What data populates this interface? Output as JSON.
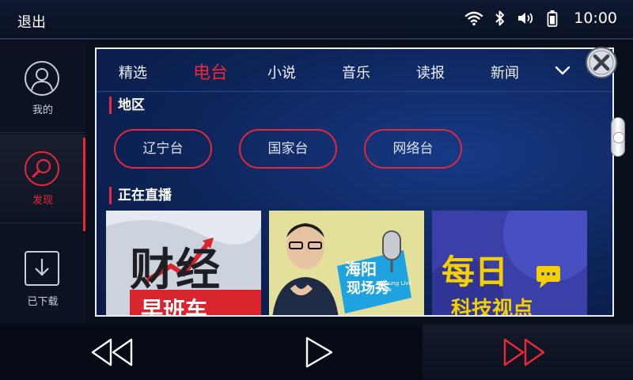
{
  "status": {
    "exit_label": "退出",
    "time": "10:00",
    "icons": [
      "wifi-icon",
      "bluetooth-icon",
      "volume-icon",
      "battery-icon"
    ]
  },
  "sidebar": {
    "items": [
      {
        "label": "我的",
        "icon": "user-icon",
        "active": false
      },
      {
        "label": "发现",
        "icon": "discover-icon",
        "active": true
      },
      {
        "label": "已下载",
        "icon": "download-icon",
        "active": false
      }
    ]
  },
  "tabs": {
    "items": [
      "精选",
      "电台",
      "小说",
      "音乐",
      "读报",
      "新闻"
    ],
    "active": "电台"
  },
  "region": {
    "title": "地区",
    "items": [
      "辽宁台",
      "国家台",
      "网络台"
    ]
  },
  "live": {
    "title": "正在直播",
    "items": [
      {
        "cover_text": "财经",
        "cover_sub": "早班车"
      },
      {
        "cover_text": "海阳",
        "cover_sub": "现场秀",
        "cover_badge": "HiYoung Live Show"
      },
      {
        "cover_text": "每日",
        "cover_sub": "科技视点"
      }
    ]
  },
  "colors": {
    "accent": "#e8283a",
    "panel": "#0d2458",
    "background": "#0a0f1c"
  },
  "controls": [
    "rewind-icon",
    "play-icon",
    "fast-forward-icon"
  ]
}
